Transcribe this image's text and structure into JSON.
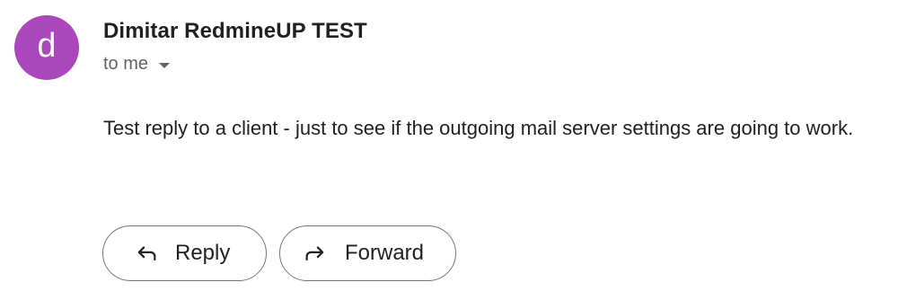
{
  "email": {
    "avatar": {
      "letter": "d",
      "color": "#ab47bc"
    },
    "sender_name": "Dimitar RedmineUP TEST",
    "recipient": "to me",
    "recipient_icon": "caret-down-icon",
    "body": "Test reply to a client - just to see if the outgoing mail server settings are going to work."
  },
  "actions": {
    "reply": {
      "label": "Reply",
      "icon": "reply-arrow-icon"
    },
    "forward": {
      "label": "Forward",
      "icon": "forward-arrow-icon"
    }
  }
}
